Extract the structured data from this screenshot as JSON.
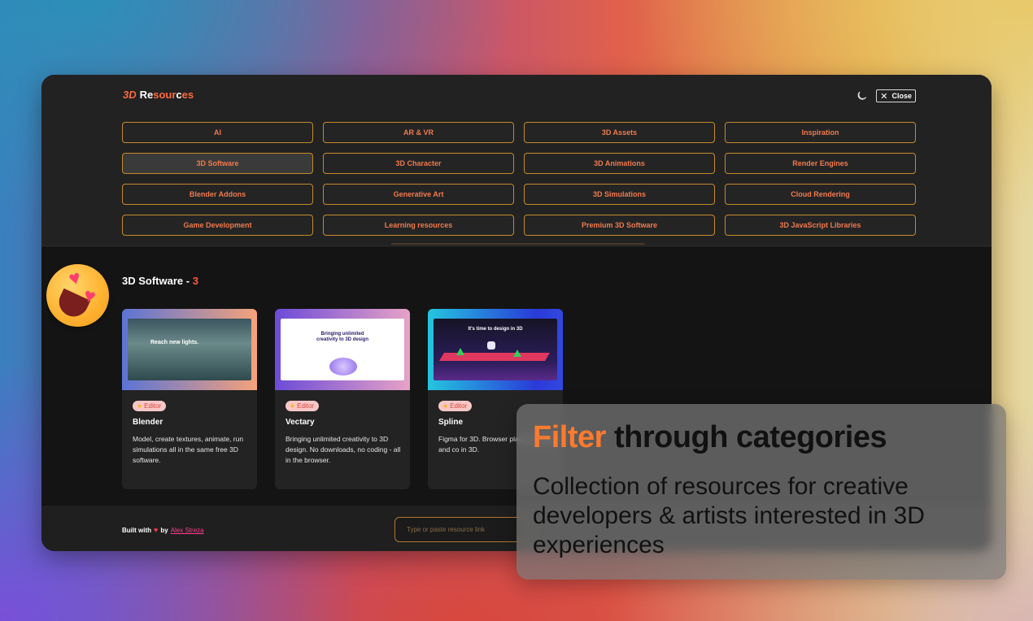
{
  "app": {
    "logo_mark": "3D",
    "logo_pre": " Re",
    "logo_mid": "sour",
    "logo_accent": "c",
    "logo_post": "es",
    "close_label": "Close"
  },
  "categories": [
    {
      "label": "AI"
    },
    {
      "label": "AR & VR"
    },
    {
      "label": "3D Assets"
    },
    {
      "label": "Inspiration"
    },
    {
      "label": "3D Software",
      "active": true
    },
    {
      "label": "3D Character"
    },
    {
      "label": "3D Animations"
    },
    {
      "label": "Render Engines"
    },
    {
      "label": "Blender Addons"
    },
    {
      "label": "Generative Art"
    },
    {
      "label": "3D Simulations"
    },
    {
      "label": "Cloud Rendering"
    },
    {
      "label": "Game Development"
    },
    {
      "label": "Learning resources"
    },
    {
      "label": "Premium 3D Software"
    },
    {
      "label": "3D JavaScript Libraries"
    }
  ],
  "section": {
    "title": "3D Software - ",
    "count": "3"
  },
  "cards": [
    {
      "badge": "Editor",
      "name": "Blender",
      "desc": "Model, create textures, animate, run simulations all in the same free 3D software.",
      "shot_text": "Reach new lights."
    },
    {
      "badge": "Editor",
      "name": "Vectary",
      "desc": "Bringing unlimited creativity to 3D design. No downloads, no coding - all in the browser.",
      "shot_text": "Bringing unlimited creativity to 3D design"
    },
    {
      "badge": "Editor",
      "name": "Spline",
      "desc": "Figma for 3D. Browser place to design and co in 3D.",
      "shot_text": "It's time to design in 3D"
    }
  ],
  "footer": {
    "built_with": "Built with",
    "by": "by",
    "author": "Alex Streza",
    "input_placeholder": "Type or paste resource link"
  },
  "overlay": {
    "highlight": "Filter",
    "title_rest": " through categories",
    "subtitle": "Collection of resources for creative developers & artists interested in 3D experiences"
  },
  "colors": {
    "accent": "#ff6b3d",
    "category_border": "#c58a2b",
    "overlay_highlight": "#ff7a2e"
  }
}
